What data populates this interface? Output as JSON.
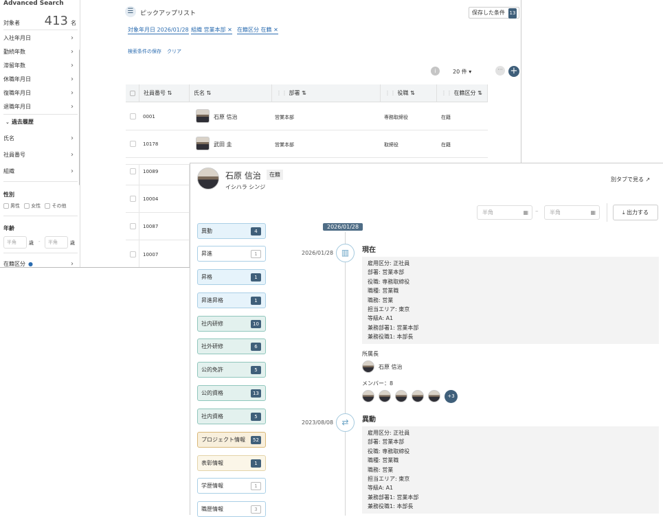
{
  "sidebar": {
    "title": "Advanced Search",
    "count_label": "対象者",
    "count_value": "413",
    "count_unit": "名",
    "items": [
      {
        "label": "入社年月日"
      },
      {
        "label": "勤続年数"
      },
      {
        "label": "滞留年数"
      },
      {
        "label": "休職年月日"
      },
      {
        "label": "復職年月日"
      },
      {
        "label": "退職年月日"
      }
    ],
    "history_label": "過去履歴",
    "history_items": [
      {
        "label": "氏名"
      },
      {
        "label": "社員番号"
      },
      {
        "label": "組織"
      }
    ],
    "gender_label": "性別",
    "gender_options": [
      "男性",
      "女性",
      "その他"
    ],
    "age_label": "年齢",
    "age_placeholder": "半角",
    "age_unit": "歳",
    "age_sep": "-",
    "status_label": "在籍区分"
  },
  "list": {
    "title": "ピックアップリスト",
    "saved_label": "保存した条件",
    "saved_count": "13",
    "filters": [
      {
        "label": "対象年月日 2026/01/28"
      },
      {
        "label": "組織 営業本部 ✕"
      },
      {
        "label": "在籍区分 在籍 ✕"
      }
    ],
    "save_condition": "検索条件の保存",
    "clear": "クリア",
    "page_size": "20 件 ▾",
    "columns": [
      "社員番号",
      "氏名",
      "部署",
      "役職",
      "在籍区分"
    ],
    "rows": [
      {
        "id": "0001",
        "name": "石原 信治",
        "dept": "営業本部",
        "title": "専務取締役",
        "status": "在籍"
      },
      {
        "id": "10178",
        "name": "武田 圭",
        "dept": "営業本部",
        "title": "取締役",
        "status": "在籍"
      },
      {
        "id": "10089"
      },
      {
        "id": "10004"
      },
      {
        "id": "10087"
      },
      {
        "id": "10007"
      }
    ]
  },
  "detail": {
    "name": "石原 信治",
    "status_badge": "在籍",
    "kana": "イシハラ シンジ",
    "open_tab": "別タブで見る",
    "date_placeholder": "半角",
    "date_sep": "–",
    "export_label": "出力する",
    "current_date_tag": "2026/01/28",
    "categories": [
      {
        "label": "異動",
        "count": "4"
      },
      {
        "label": "昇進",
        "count": "1"
      },
      {
        "label": "昇格",
        "count": "1"
      },
      {
        "label": "昇進昇格",
        "count": "1"
      },
      {
        "label": "社内研修",
        "count": "10"
      },
      {
        "label": "社外研修",
        "count": "6"
      },
      {
        "label": "公的免許",
        "count": "5"
      },
      {
        "label": "公的資格",
        "count": "13"
      },
      {
        "label": "社内資格",
        "count": "5"
      },
      {
        "label": "プロジェクト情報",
        "count": "52"
      },
      {
        "label": "表彰情報",
        "count": "1"
      },
      {
        "label": "学歴情報",
        "count": "1"
      },
      {
        "label": "職歴情報",
        "count": "3"
      }
    ],
    "timeline": [
      {
        "date": "2026/01/28",
        "heading": "現在",
        "lines": [
          "雇用区分: 正社員",
          "部署: 営業本部",
          "役職: 専務取締役",
          "職種: 営業職",
          "職務: 営業",
          "担当エリア: 東京",
          "等級A: A1",
          "兼務部署1: 営業本部",
          "兼務役職1: 本部長"
        ]
      },
      {
        "date": "2023/08/08",
        "heading": "異動",
        "lines": [
          "雇用区分: 正社員",
          "部署: 営業本部",
          "役職: 専務取締役",
          "職種: 営業職",
          "職務: 営業",
          "担当エリア: 東京",
          "等級A: A1",
          "兼務部署1: 営業本部",
          "兼務役職1: 本部長"
        ]
      }
    ],
    "manager_label": "所属長",
    "manager_name": "石原 信治",
    "members_label": "メンバー：8",
    "members_more": "+3"
  }
}
